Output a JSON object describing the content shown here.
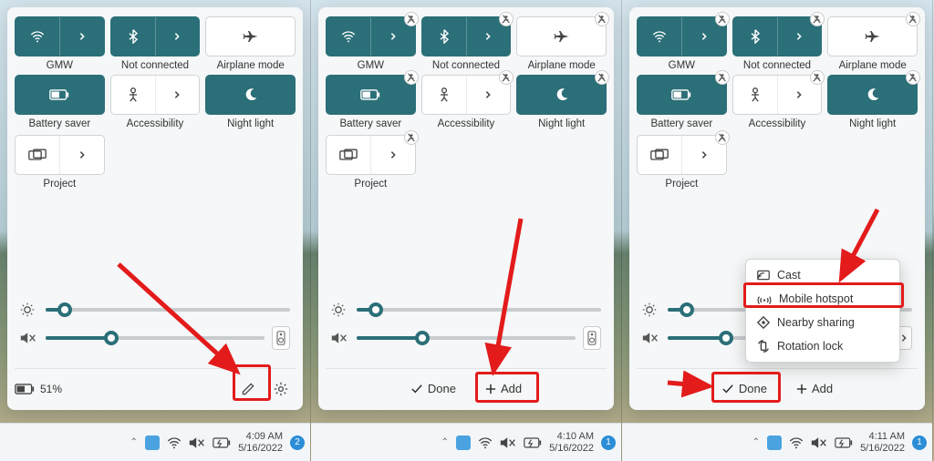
{
  "colors": {
    "accent": "#2b6f78",
    "alert": "#e31b1b"
  },
  "panels": [
    {
      "id": 0,
      "edit_mode": false,
      "tiles": [
        {
          "key": "wifi",
          "label": "GMW",
          "icon": "wifi",
          "on": true,
          "chevron": true,
          "pin": false
        },
        {
          "key": "bluetooth",
          "label": "Not connected",
          "icon": "bluetooth",
          "on": true,
          "chevron": true,
          "pin": false
        },
        {
          "key": "airplane",
          "label": "Airplane mode",
          "icon": "airplane",
          "on": false,
          "chevron": false,
          "pin": false
        },
        {
          "key": "battery-saver",
          "label": "Battery saver",
          "icon": "battery",
          "on": true,
          "chevron": false,
          "pin": false
        },
        {
          "key": "accessibility",
          "label": "Accessibility",
          "icon": "person",
          "on": false,
          "chevron": true,
          "pin": false
        },
        {
          "key": "night-light",
          "label": "Night light",
          "icon": "nightlight",
          "on": true,
          "chevron": false,
          "pin": false
        },
        {
          "key": "project",
          "label": "Project",
          "icon": "project",
          "on": false,
          "chevron": true,
          "pin": false
        }
      ],
      "brightness_pct": 8,
      "volume_pct": 30,
      "battery_text": "51%",
      "footer": {
        "kind": "edit-gear"
      },
      "taskbar": {
        "time": "4:09 AM",
        "date": "5/16/2022",
        "badge": "2"
      }
    },
    {
      "id": 1,
      "edit_mode": true,
      "tiles": [
        {
          "key": "wifi",
          "label": "GMW",
          "icon": "wifi",
          "on": true,
          "chevron": true,
          "pin": true
        },
        {
          "key": "bluetooth",
          "label": "Not connected",
          "icon": "bluetooth",
          "on": true,
          "chevron": true,
          "pin": true
        },
        {
          "key": "airplane",
          "label": "Airplane mode",
          "icon": "airplane",
          "on": false,
          "chevron": false,
          "pin": true
        },
        {
          "key": "battery-saver",
          "label": "Battery saver",
          "icon": "battery",
          "on": true,
          "chevron": false,
          "pin": true
        },
        {
          "key": "accessibility",
          "label": "Accessibility",
          "icon": "person",
          "on": false,
          "chevron": true,
          "pin": true
        },
        {
          "key": "night-light",
          "label": "Night light",
          "icon": "nightlight",
          "on": true,
          "chevron": false,
          "pin": true
        },
        {
          "key": "project",
          "label": "Project",
          "icon": "project",
          "on": false,
          "chevron": true,
          "pin": true
        }
      ],
      "brightness_pct": 8,
      "volume_pct": 30,
      "footer": {
        "kind": "done-add",
        "done_label": "Done",
        "add_label": "Add"
      },
      "taskbar": {
        "time": "4:10 AM",
        "date": "5/16/2022",
        "badge": "1"
      }
    },
    {
      "id": 2,
      "edit_mode": true,
      "tiles": [
        {
          "key": "wifi",
          "label": "GMW",
          "icon": "wifi",
          "on": true,
          "chevron": true,
          "pin": true
        },
        {
          "key": "bluetooth",
          "label": "Not connected",
          "icon": "bluetooth",
          "on": true,
          "chevron": true,
          "pin": true
        },
        {
          "key": "airplane",
          "label": "Airplane mode",
          "icon": "airplane",
          "on": false,
          "chevron": false,
          "pin": true
        },
        {
          "key": "battery-saver",
          "label": "Battery saver",
          "icon": "battery",
          "on": true,
          "chevron": false,
          "pin": true
        },
        {
          "key": "accessibility",
          "label": "Accessibility",
          "icon": "person",
          "on": false,
          "chevron": true,
          "pin": true
        },
        {
          "key": "night-light",
          "label": "Night light",
          "icon": "nightlight",
          "on": true,
          "chevron": false,
          "pin": true
        },
        {
          "key": "project",
          "label": "Project",
          "icon": "project",
          "on": false,
          "chevron": true,
          "pin": true
        }
      ],
      "brightness_pct": 8,
      "volume_pct": 30,
      "footer": {
        "kind": "done-add",
        "done_label": "Done",
        "add_label": "Add"
      },
      "menu": {
        "items": [
          {
            "key": "cast",
            "label": "Cast",
            "icon": "cast"
          },
          {
            "key": "mobile-hotspot",
            "label": "Mobile hotspot",
            "icon": "hotspot"
          },
          {
            "key": "nearby-sharing",
            "label": "Nearby sharing",
            "icon": "nearby"
          },
          {
            "key": "rotation-lock",
            "label": "Rotation lock",
            "icon": "rotation"
          }
        ]
      },
      "taskbar": {
        "time": "4:11 AM",
        "date": "5/16/2022",
        "badge": "1"
      }
    }
  ]
}
